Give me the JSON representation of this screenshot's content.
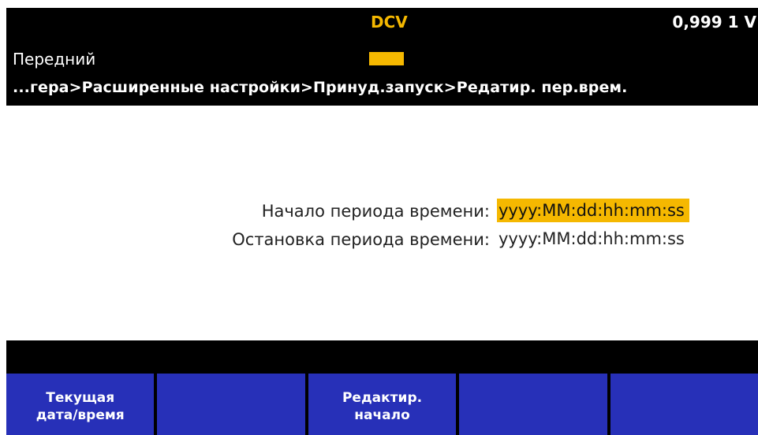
{
  "header": {
    "function": "DCV",
    "reading": "0,999 1 V",
    "terminal": "Передний",
    "breadcrumb": "...гера>Расширенные настройки>Принуд.запуск>Редатир. пер.врем."
  },
  "fields": [
    {
      "label": "Начало периода времени:",
      "value": "yyyy:MM:dd:hh:mm:ss",
      "selected": true
    },
    {
      "label": "Остановка периода времени:",
      "value": "yyyy:MM:dd:hh:mm:ss",
      "selected": false
    }
  ],
  "softkeys": [
    {
      "line1": "Текущая",
      "line2": "дата/время"
    },
    {
      "line1": "",
      "line2": ""
    },
    {
      "line1": "Редактир.",
      "line2": "начало"
    },
    {
      "line1": "",
      "line2": ""
    },
    {
      "line1": "",
      "line2": ""
    }
  ],
  "colors": {
    "accent": "#f5b800",
    "softkey": "#2730b8",
    "background": "#000000"
  }
}
